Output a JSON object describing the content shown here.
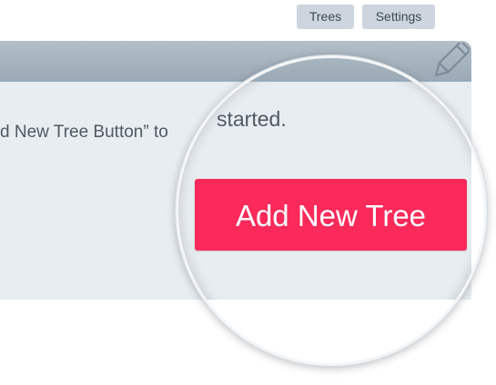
{
  "top_nav": {
    "trees_label": "Trees",
    "settings_label": "Settings"
  },
  "panel": {
    "instruction_text": "d New Tree Button” to",
    "magnified_text": "started.",
    "add_button_label": "Add New Tree",
    "header_icon": "pencil-icon"
  },
  "colors": {
    "accent": "#fb2a5a",
    "header": "#a4b2be",
    "panel_bg": "#e8edf1",
    "nav_button_bg": "#cdd6de"
  }
}
